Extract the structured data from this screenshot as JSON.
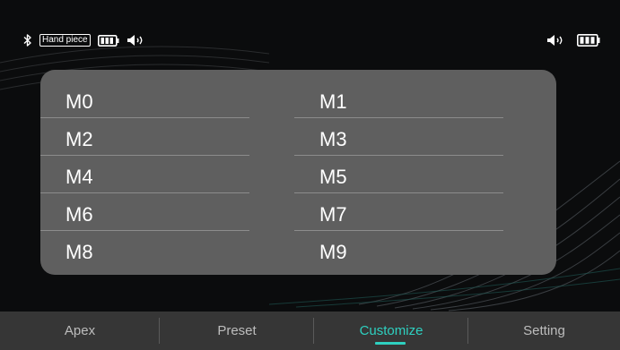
{
  "status_bar": {
    "left_icons": [
      "bluetooth-icon",
      "battery-icon",
      "volume-icon"
    ],
    "handpiece_label": "Hand piece",
    "right_icons": [
      "volume-icon",
      "battery-icon"
    ]
  },
  "memory_slots": [
    "M0",
    "M1",
    "M2",
    "M3",
    "M4",
    "M5",
    "M6",
    "M7",
    "M8",
    "M9"
  ],
  "tabs": [
    {
      "label": "Apex",
      "active": false
    },
    {
      "label": "Preset",
      "active": false
    },
    {
      "label": "Customize",
      "active": true
    },
    {
      "label": "Setting",
      "active": false
    }
  ],
  "colors": {
    "accent": "#2ed0c0",
    "panel": "#5f5f5f",
    "background": "#0b0c0d",
    "tabbar": "#363636"
  }
}
